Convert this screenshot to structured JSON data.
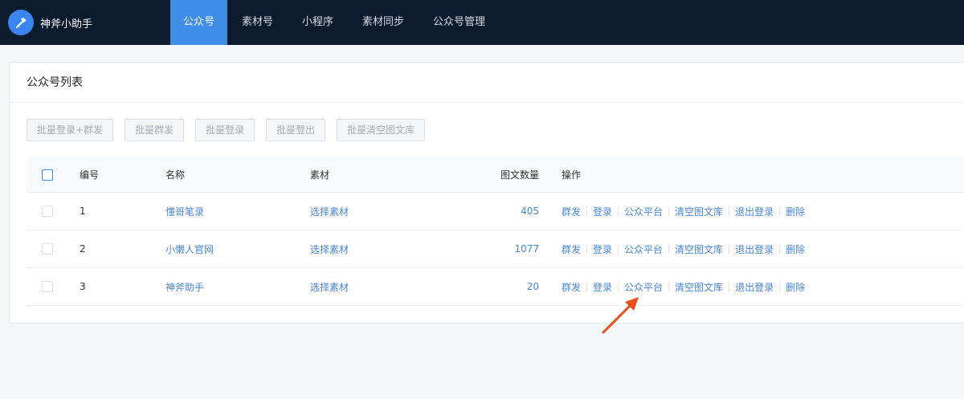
{
  "app": {
    "name": "神斧小助手",
    "icon": "axe-icon"
  },
  "nav": [
    {
      "label": "公众号",
      "active": true
    },
    {
      "label": "素材号",
      "active": false
    },
    {
      "label": "小程序",
      "active": false
    },
    {
      "label": "素材同步",
      "active": false
    },
    {
      "label": "公众号管理",
      "active": false
    }
  ],
  "card": {
    "title": "公众号列表"
  },
  "toolbar": [
    {
      "label": "批量登录+群发"
    },
    {
      "label": "批量群发"
    },
    {
      "label": "批量登录"
    },
    {
      "label": "批量登出"
    },
    {
      "label": "批量清空图文库"
    }
  ],
  "table": {
    "headers": {
      "num": "编号",
      "name": "名称",
      "material": "素材",
      "count": "图文数量",
      "ops": "操作"
    },
    "rows": [
      {
        "num": "1",
        "name": "懂哥笔录",
        "material": "选择素材",
        "count": "405"
      },
      {
        "num": "2",
        "name": "小懒人官网",
        "material": "选择素材",
        "count": "1077"
      },
      {
        "num": "3",
        "name": "神斧助手",
        "material": "选择素材",
        "count": "20"
      }
    ],
    "ops": [
      "群发",
      "登录",
      "公众平台",
      "清空图文库",
      "退出登录",
      "删除"
    ]
  },
  "colors": {
    "topbar": "#0d1b2e",
    "accent": "#3e8ee8",
    "link": "#4a86d8",
    "annotation": "#e8501a"
  }
}
